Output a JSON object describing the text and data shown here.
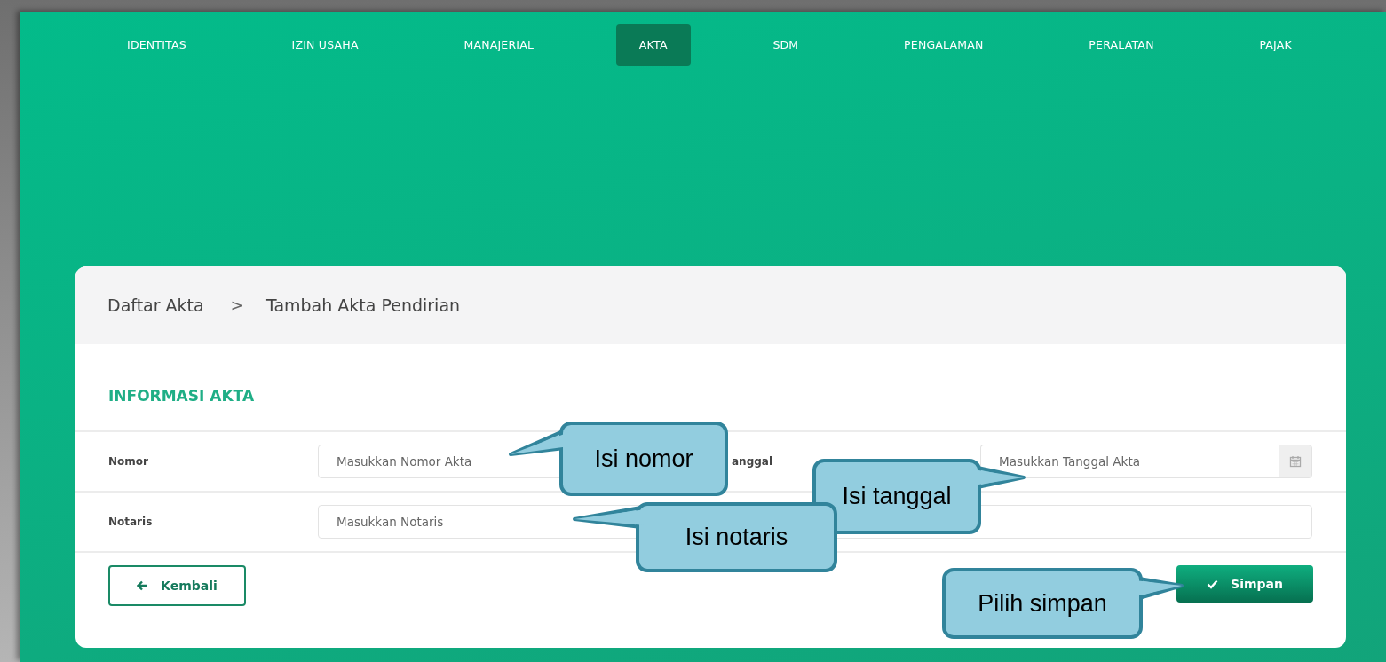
{
  "nav": {
    "tabs": [
      {
        "label": "IDENTITAS",
        "selected": false
      },
      {
        "label": "IZIN USAHA",
        "selected": false
      },
      {
        "label": "MANAJERIAL",
        "selected": false
      },
      {
        "label": "AKTA",
        "selected": true
      },
      {
        "label": "SDM",
        "selected": false
      },
      {
        "label": "PENGALAMAN",
        "selected": false
      },
      {
        "label": "PERALATAN",
        "selected": false
      },
      {
        "label": "PAJAK",
        "selected": false
      }
    ]
  },
  "breadcrumb": {
    "items": [
      "Daftar Akta",
      "Tambah Akta Pendirian"
    ],
    "separator": ">"
  },
  "section_title": "INFORMASI AKTA",
  "form": {
    "nomor": {
      "label": "Nomor",
      "placeholder": "Masukkan Nomor Akta"
    },
    "tanggal": {
      "label": "anggal",
      "placeholder": "Masukkan Tanggal Akta"
    },
    "notaris": {
      "label": "Notaris",
      "placeholder": "Masukkan Notaris"
    }
  },
  "buttons": {
    "back": "Kembali",
    "save": "Simpan"
  },
  "callouts": [
    {
      "text": "Isi nomor"
    },
    {
      "text": "Isi tanggal"
    },
    {
      "text": "Isi notaris"
    },
    {
      "text": "Pilih simpan"
    }
  ]
}
